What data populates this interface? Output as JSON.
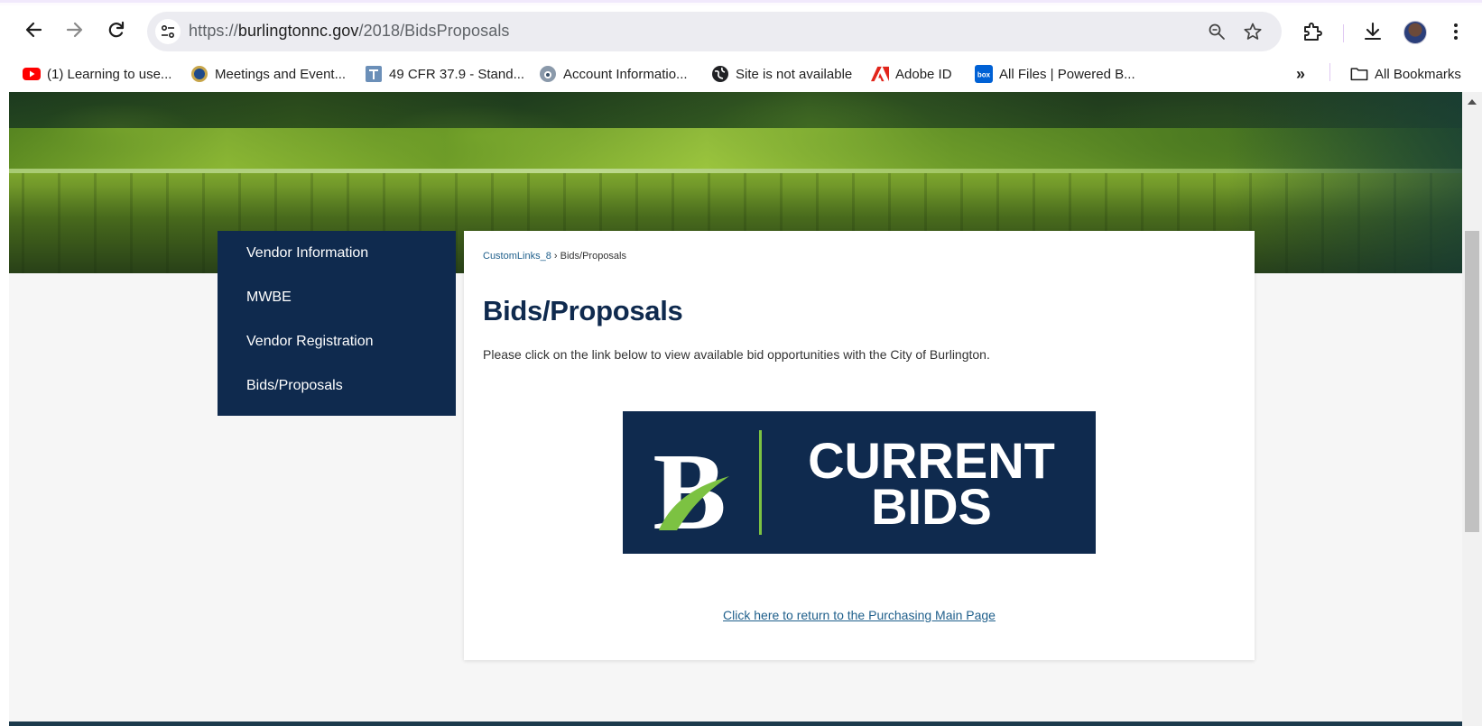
{
  "browser": {
    "url_prefix": "https://",
    "url_host": "burlingtonnc.gov",
    "url_path": "/2018/BidsProposals",
    "bookmarks": [
      {
        "label": "(1) Learning to use...",
        "icon": "youtube-icon"
      },
      {
        "label": "Meetings and Event...",
        "icon": "seal-icon"
      },
      {
        "label": "49 CFR 37.9 - Stand...",
        "icon": "law-icon"
      },
      {
        "label": "Account Informatio...",
        "icon": "account-icon"
      },
      {
        "label": "Site is not available",
        "icon": "globe-icon"
      },
      {
        "label": "Adobe ID",
        "icon": "adobe-icon"
      },
      {
        "label": "All Files | Powered B...",
        "icon": "box-icon"
      }
    ],
    "overflow_label": "»",
    "all_bookmarks_label": "All Bookmarks"
  },
  "sidebar": {
    "items": [
      {
        "label": "Vendor Information"
      },
      {
        "label": "MWBE"
      },
      {
        "label": "Vendor Registration"
      },
      {
        "label": "Bids/Proposals"
      }
    ]
  },
  "content": {
    "breadcrumb": {
      "link": "CustomLinks_8",
      "separator": "›",
      "current": "Bids/Proposals"
    },
    "title": "Bids/Proposals",
    "intro": "Please click on the link below to view available bid opportunities with the City of Burlington.",
    "banner": {
      "logo_letter": "B",
      "line1": "CURRENT",
      "line2": "BIDS"
    },
    "return_link": "Click here to return to the Purchasing Main Page"
  },
  "colors": {
    "navy": "#0f2a4e",
    "accent_green": "#7cc242",
    "link": "#1f5f8b"
  }
}
